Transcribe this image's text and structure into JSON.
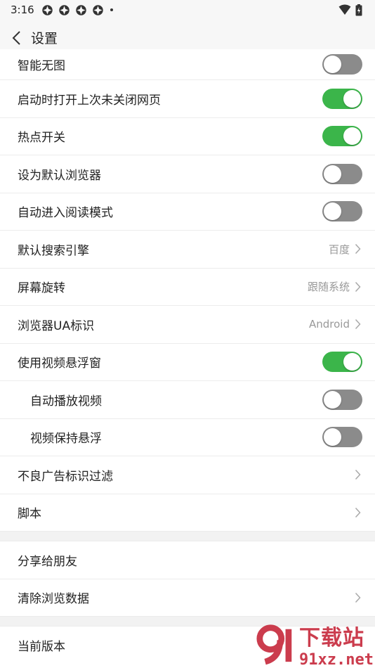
{
  "status_bar": {
    "time": "3:16",
    "app_icons": [
      "app-notification-icon",
      "app-notification-icon",
      "app-notification-icon",
      "app-notification-icon"
    ],
    "icons": [
      "wifi-icon",
      "battery-icon"
    ]
  },
  "header": {
    "title": "设置",
    "back_icon": "chevron-left-icon"
  },
  "settings": [
    {
      "label": "智能无图",
      "type": "toggle",
      "on": false
    },
    {
      "label": "启动时打开上次未关闭网页",
      "type": "toggle",
      "on": true
    },
    {
      "label": "热点开关",
      "type": "toggle",
      "on": true
    },
    {
      "label": "设为默认浏览器",
      "type": "toggle",
      "on": false
    },
    {
      "label": "自动进入阅读模式",
      "type": "toggle",
      "on": false
    },
    {
      "label": "默认搜索引擎",
      "type": "select",
      "value": "百度"
    },
    {
      "label": "屏幕旋转",
      "type": "select",
      "value": "跟随系统"
    },
    {
      "label": "浏览器UA标识",
      "type": "select",
      "value": "Android"
    },
    {
      "label": "使用视频悬浮窗",
      "type": "toggle",
      "on": true
    },
    {
      "label": "自动播放视频",
      "type": "toggle",
      "on": false,
      "indent": true
    },
    {
      "label": "视频保持悬浮",
      "type": "toggle",
      "on": false,
      "indent": true
    },
    {
      "label": "不良广告标识过滤",
      "type": "link"
    },
    {
      "label": "脚本",
      "type": "link"
    }
  ],
  "group2": [
    {
      "label": "分享给朋友",
      "type": "plain"
    },
    {
      "label": "清除浏览数据",
      "type": "link"
    }
  ],
  "group3": [
    {
      "label": "当前版本",
      "type": "plain"
    }
  ],
  "watermark": {
    "top_text": "下载站",
    "bottom_text": "91xz.net",
    "color": "#c6283a"
  },
  "colors": {
    "toggle_on": "#3bb54a",
    "toggle_off": "#8b8b8b"
  }
}
